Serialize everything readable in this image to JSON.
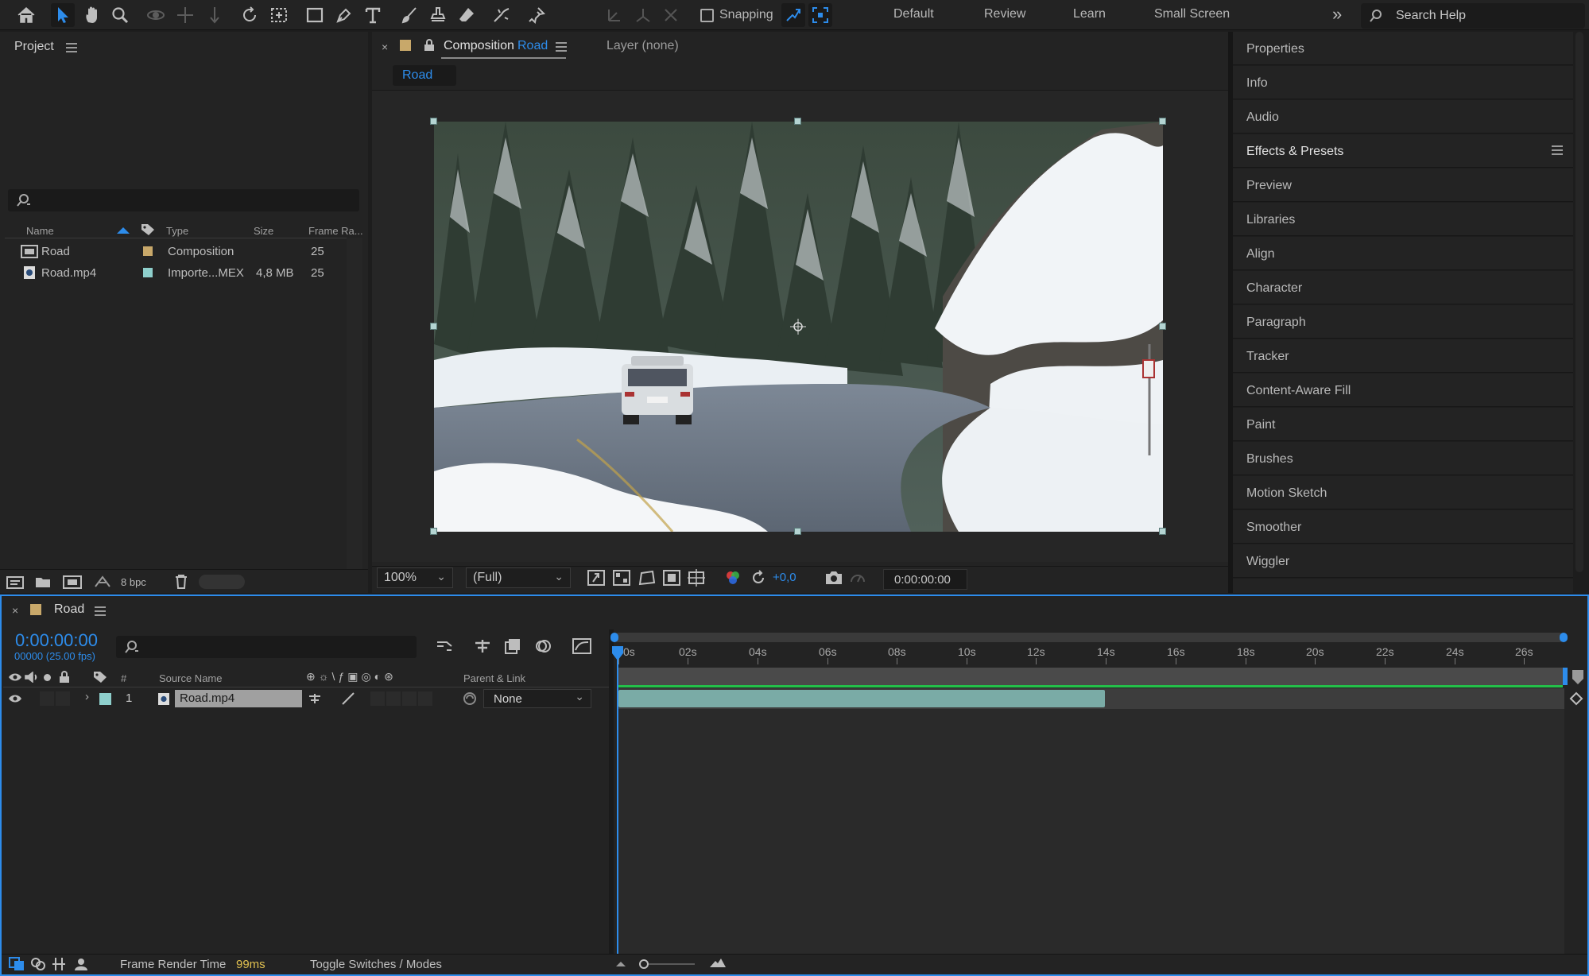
{
  "toolbar": {
    "snapping_label": "Snapping",
    "workspaces": [
      "Default",
      "Review",
      "Learn",
      "Small Screen"
    ],
    "search_placeholder": "Search Help",
    "accent_color": "#2d8ceb"
  },
  "project": {
    "title": "Project",
    "columns": {
      "name": "Name",
      "type": "Type",
      "size": "Size",
      "frame_rate": "Frame Ra..."
    },
    "rows": [
      {
        "name": "Road",
        "type": "Composition",
        "size": "",
        "frame_rate": "25",
        "label_color": "#c8a86a"
      },
      {
        "name": "Road.mp4",
        "type": "Importe...MEX",
        "size": "4,8 MB",
        "frame_rate": "25",
        "label_color": "#8ecfcc"
      }
    ],
    "bpc": "8 bpc"
  },
  "composition": {
    "tab_prefix": "Composition",
    "tab_name": "Road",
    "layer_tab": "Layer (none)",
    "breadcrumb": "Road",
    "zoom": "100%",
    "resolution": "(Full)",
    "exposure": "+0,0",
    "timecode": "0:00:00:00"
  },
  "right_panel": {
    "items": [
      "Properties",
      "Info",
      "Audio",
      "Effects & Presets",
      "Preview",
      "Libraries",
      "Align",
      "Character",
      "Paragraph",
      "Tracker",
      "Content-Aware Fill",
      "Paint",
      "Brushes",
      "Motion Sketch",
      "Smoother",
      "Wiggler"
    ]
  },
  "timeline": {
    "comp_name": "Road",
    "current_time": "0:00:00:00",
    "frame_info": "00000 (25.00 fps)",
    "columns": {
      "num": "#",
      "source_name": "Source Name",
      "parent": "Parent & Link"
    },
    "ruler": [
      "0s",
      "02s",
      "04s",
      "06s",
      "08s",
      "10s",
      "12s",
      "14s",
      "16s",
      "18s",
      "20s",
      "22s",
      "24s",
      "26s"
    ],
    "layers": [
      {
        "num": "1",
        "name": "Road.mp4",
        "parent": "None",
        "label_color": "#8ecfcc"
      }
    ],
    "footer": {
      "render_label": "Frame Render Time",
      "render_value": "99ms",
      "toggle": "Toggle Switches / Modes"
    }
  }
}
